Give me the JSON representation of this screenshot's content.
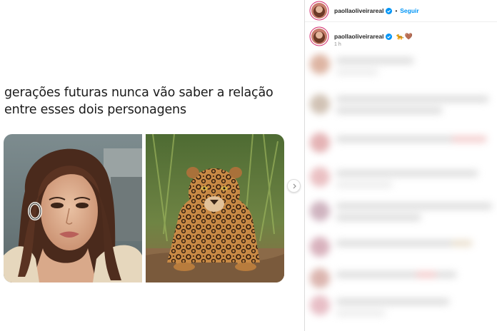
{
  "post": {
    "text_line1": "gerações futuras nunca vão saber a relação",
    "text_line2": "entre esses dois personagens"
  },
  "header": {
    "username": "paollaoliveirareal",
    "separator": "•",
    "follow_label": "Seguir"
  },
  "caption": {
    "username": "paollaoliveirareal",
    "emojis": "🐆🤎",
    "time": "1 h"
  },
  "icons": {
    "verified": "verified-badge-icon",
    "next": "chevron-right-icon"
  },
  "colors": {
    "follow_blue": "#0095f6",
    "verified_blue": "#0095f6",
    "story_ring": "#d42a6e",
    "secondary_text": "#8e8e8e"
  }
}
